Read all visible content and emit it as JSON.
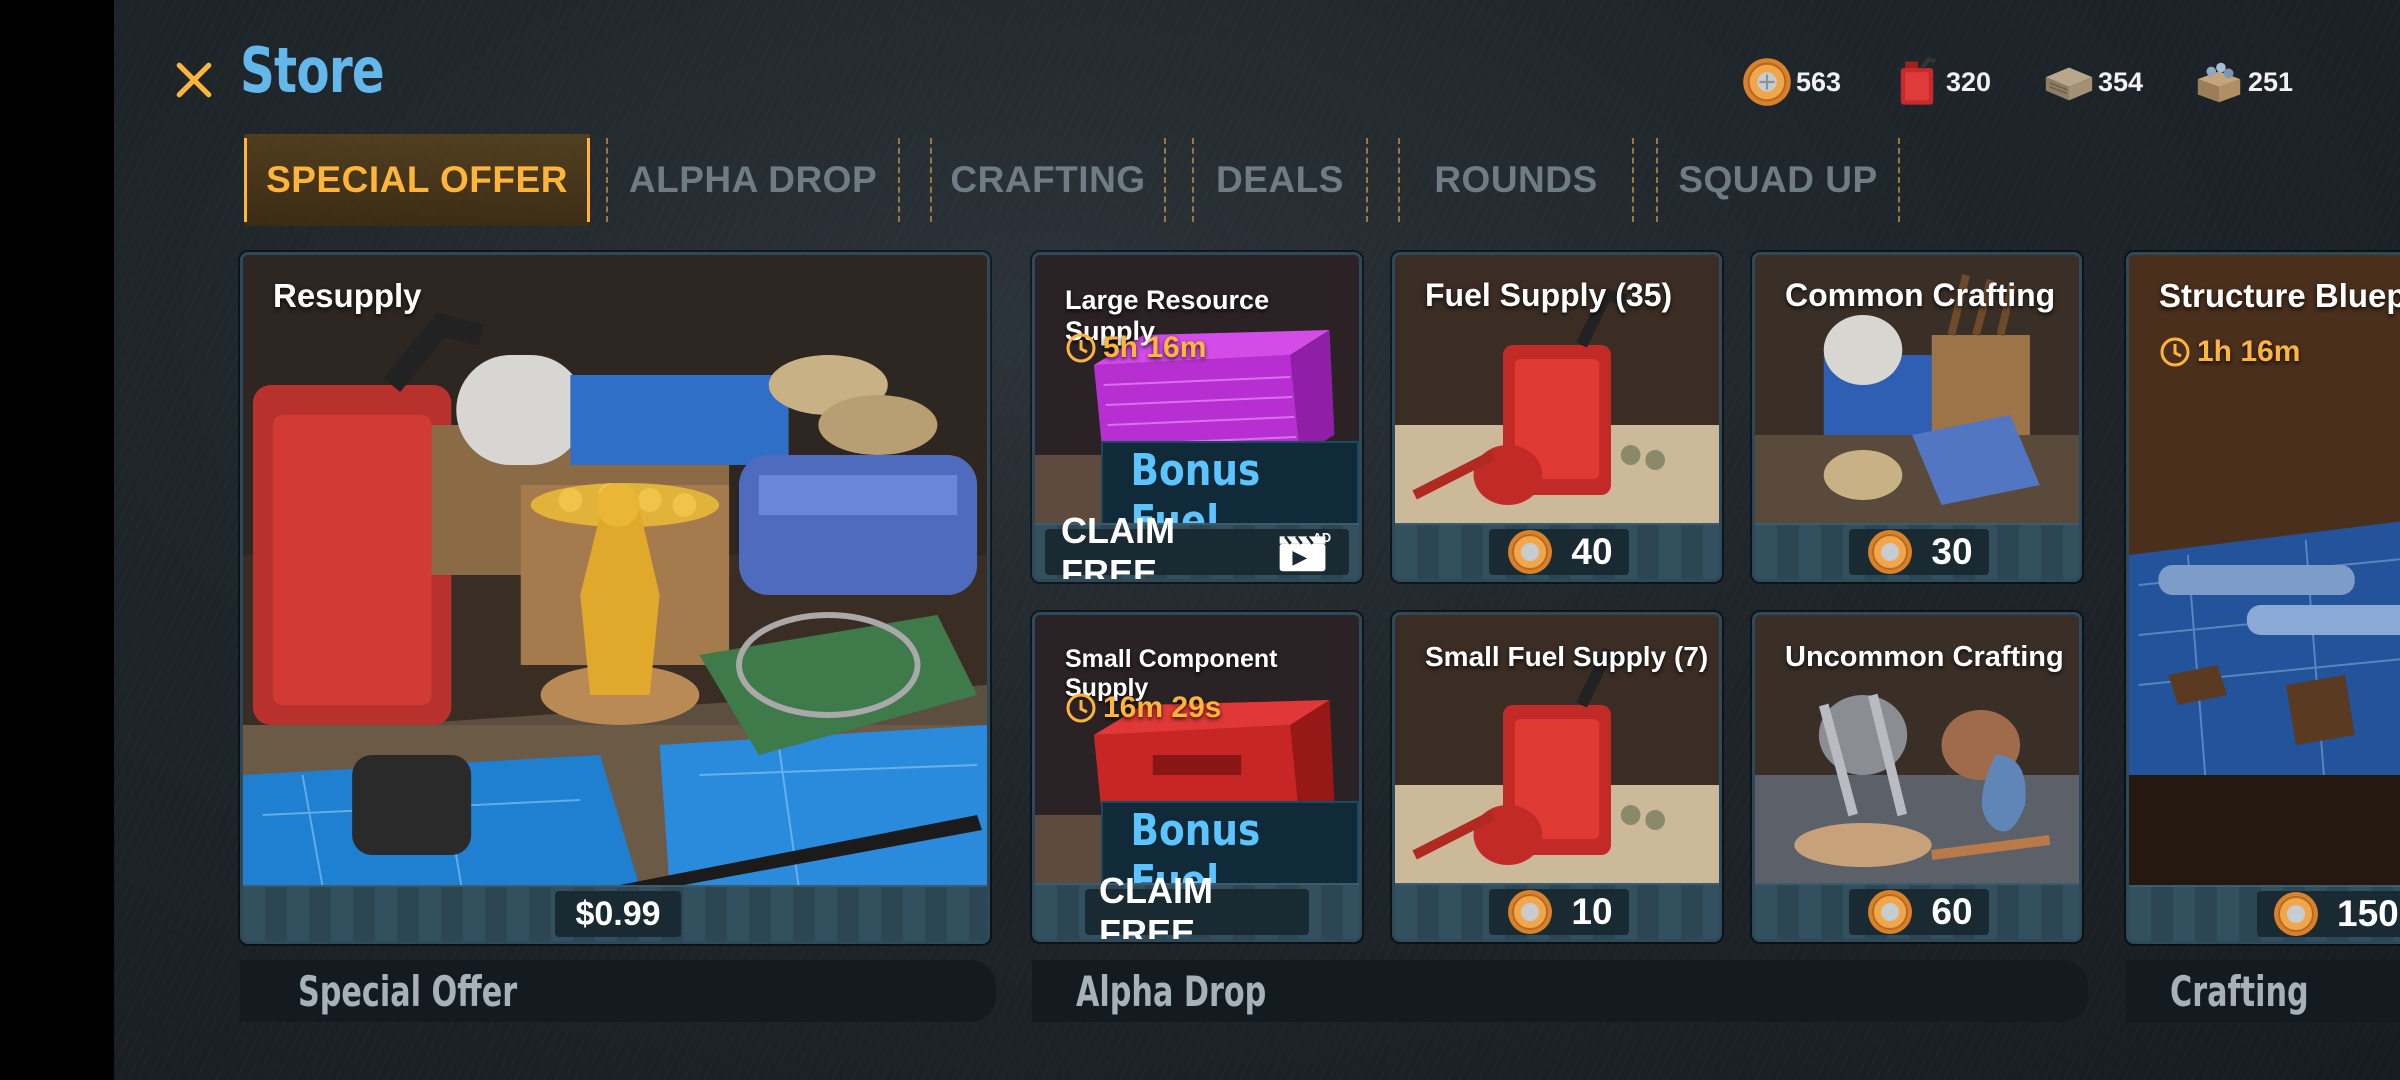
{
  "header": {
    "title": "Store"
  },
  "currencies": [
    {
      "icon": "coin-icon",
      "value": "563"
    },
    {
      "icon": "fuel-can-icon",
      "value": "320"
    },
    {
      "icon": "wood-pallet-icon",
      "value": "354"
    },
    {
      "icon": "component-crate-icon",
      "value": "251"
    }
  ],
  "tabs": [
    {
      "label": "SPECIAL OFFER",
      "active": true
    },
    {
      "label": "ALPHA DROP",
      "active": false
    },
    {
      "label": "CRAFTING",
      "active": false
    },
    {
      "label": "DEALS",
      "active": false
    },
    {
      "label": "ROUNDS",
      "active": false
    },
    {
      "label": "SQUAD UP",
      "active": false
    }
  ],
  "cards": {
    "resupply": {
      "title": "Resupply",
      "price": "$0.99"
    },
    "large_resource": {
      "title": "Large Resource Supply",
      "timer": "5h 16m",
      "bonus": "Bonus Fuel",
      "action": "CLAIM FREE",
      "ad_badge": "AD"
    },
    "small_component": {
      "title": "Small Component Supply",
      "timer": "16m 29s",
      "bonus": "Bonus Fuel",
      "action": "CLAIM FREE"
    },
    "fuel_supply": {
      "title": "Fuel Supply (35)",
      "price": "40"
    },
    "small_fuel_supply": {
      "title": "Small Fuel Supply (7)",
      "price": "10"
    },
    "common_crafting": {
      "title": "Common Crafting",
      "price": "30"
    },
    "uncommon_crafting": {
      "title": "Uncommon Crafting",
      "price": "60"
    },
    "structure_blueprint": {
      "title": "Structure Bluep",
      "timer": "1h 16m",
      "price": "150"
    }
  },
  "sections": {
    "special_offer": "Special Offer",
    "alpha_drop": "Alpha Drop",
    "crafting": "Crafting"
  },
  "colors": {
    "accent_orange": "#ffb43c",
    "title_blue": "#63b7ea",
    "bonus_blue": "#5cc4ff"
  }
}
